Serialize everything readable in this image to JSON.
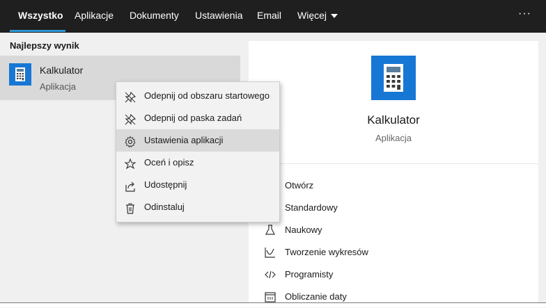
{
  "tabs": [
    {
      "label": "Wszystko",
      "active": true
    },
    {
      "label": "Aplikacje"
    },
    {
      "label": "Dokumenty"
    },
    {
      "label": "Ustawienia"
    },
    {
      "label": "Email"
    },
    {
      "label": "Więcej"
    }
  ],
  "more_label": "···",
  "left": {
    "section_title": "Najlepszy wynik",
    "best_result": {
      "name": "Kalkulator",
      "type": "Aplikacja"
    }
  },
  "context_menu": {
    "items": [
      {
        "label": "Odepnij od obszaru startowego",
        "icon": "unpin-icon"
      },
      {
        "label": "Odepnij od paska zadań",
        "icon": "unpin-icon"
      },
      {
        "label": "Ustawienia aplikacji",
        "icon": "gear-icon"
      },
      {
        "label": "Oceń i opisz",
        "icon": "rate-review-icon"
      },
      {
        "label": "Udostępnij",
        "icon": "share-icon"
      },
      {
        "label": "Odinstaluj",
        "icon": "trash-icon"
      }
    ],
    "highlighted_index": 2
  },
  "detail": {
    "name": "Kalkulator",
    "type": "Aplikacja",
    "actions": [
      {
        "label": "Otwórz",
        "icon": "open-icon"
      },
      {
        "label": "Standardowy",
        "icon": "standard-calculator-icon"
      },
      {
        "label": "Naukowy",
        "icon": "flask-icon"
      },
      {
        "label": "Tworzenie wykresów",
        "icon": "graph-icon"
      },
      {
        "label": "Programisty",
        "icon": "code-icon"
      },
      {
        "label": "Obliczanie daty",
        "icon": "calendar-icon"
      }
    ]
  },
  "colors": {
    "topbar": "#1f1f1f",
    "accent": "#2e96d6",
    "app_tile": "#1777d4"
  }
}
